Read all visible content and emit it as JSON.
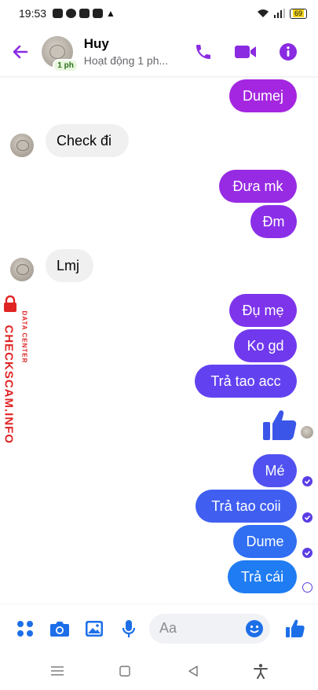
{
  "status_bar": {
    "time": "19:53",
    "battery": "69"
  },
  "header": {
    "contact_name": "Huy",
    "contact_status": "Hoạt động 1 ph...",
    "active_badge": "1 ph",
    "accent_color": "#8a2be2"
  },
  "messages": [
    {
      "direction": "out",
      "text": "Dumej"
    },
    {
      "direction": "in",
      "text": "Check đi"
    },
    {
      "direction": "out",
      "text": "Đưa mk"
    },
    {
      "direction": "out",
      "text": "Đm"
    },
    {
      "direction": "in",
      "text": "Lmj"
    },
    {
      "direction": "out",
      "text": "Đụ mẹ"
    },
    {
      "direction": "out",
      "text": "Ko gd"
    },
    {
      "direction": "out",
      "text": "Trả tao acc"
    },
    {
      "direction": "out",
      "type": "like-sticker"
    },
    {
      "direction": "out",
      "text": "Mé",
      "receipt": "read"
    },
    {
      "direction": "out",
      "text": "Trả tao coii",
      "receipt": "read"
    },
    {
      "direction": "out",
      "text": "Dume",
      "receipt": "read"
    },
    {
      "direction": "out",
      "text": "Trả cái",
      "receipt": "sent"
    }
  ],
  "watermark": {
    "brand": "CHECKSCAM.INFO",
    "subtitle": "DATA CENTER",
    "color": "#e02424"
  },
  "composer": {
    "placeholder": "Aa",
    "icons": [
      "apps-icon",
      "camera-icon",
      "gallery-icon",
      "microphone-icon",
      "emoji-icon",
      "like-icon"
    ]
  },
  "theme": {
    "bubble_gradient_top": "#a426e0",
    "bubble_gradient_mid": "#6a3bf0",
    "bubble_gradient_bottom": "#1f7cf2",
    "icon_blue": "#1d6fe8"
  }
}
